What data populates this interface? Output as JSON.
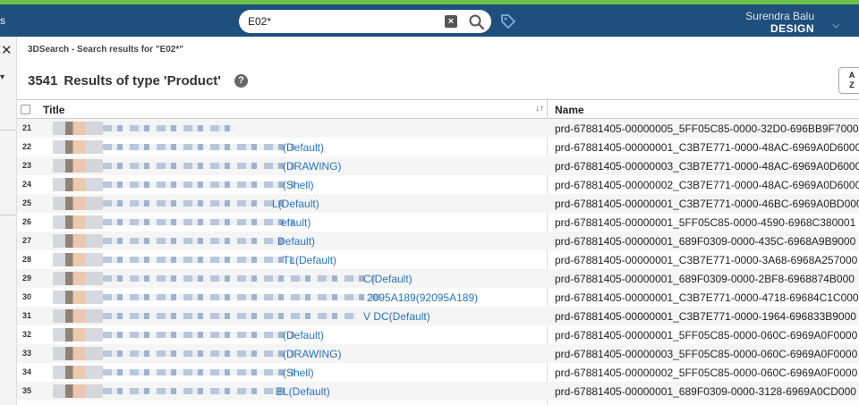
{
  "header": {
    "left_label": "s",
    "search_value": "E02*",
    "user_name": "Surendra Balu",
    "user_role": "DESIGN"
  },
  "breadcrumb": "3DSearch - Search results for \"E02*\"",
  "results": {
    "count": "3541",
    "label": "Results of type 'Product'"
  },
  "table": {
    "columns": [
      "Title",
      "Name"
    ],
    "rows": [
      {
        "num": "21",
        "title": "",
        "name": "prd-67881405-00000005_5FF05C85-0000-32D0-696BB9F7000"
      },
      {
        "num": "22",
        "title": "(Default)",
        "name": "prd-67881405-00000001_C3B7E771-0000-48AC-6969A0D6000"
      },
      {
        "num": "23",
        "title": "(DRAWING)",
        "name": "prd-67881405-00000003_C3B7E771-0000-48AC-6969A0D6000"
      },
      {
        "num": "24",
        "title": "(Shell)",
        "name": "prd-67881405-00000002_C3B7E771-0000-48AC-6969A0D6000"
      },
      {
        "num": "25",
        "title": "L(Default)",
        "name": "prd-67881405-00000001_C3B7E771-0000-46BC-6969A0BD000"
      },
      {
        "num": "26",
        "title": "efault)",
        "name": "prd-67881405-00000001_5FF05C85-0000-4590-6968C380001"
      },
      {
        "num": "27",
        "title": "Default)",
        "name": "prd-67881405-00000001_689F0309-0000-435C-6968A9B9000"
      },
      {
        "num": "28",
        "title": "TL(Default)",
        "name": "prd-67881405-00000001_C3B7E771-0000-3A68-6968A257000"
      },
      {
        "num": "29",
        "title": "C(Default)",
        "name": "prd-67881405-00000001_689F0309-0000-2BF8-6968874B000"
      },
      {
        "num": "30",
        "title": "2095A189(92095A189)",
        "name": "prd-67881405-00000001_C3B7E771-0000-4718-69684C1C000"
      },
      {
        "num": "31",
        "title": "V DC(Default)",
        "name": "prd-67881405-00000001_C3B7E771-0000-1964-696833B9000"
      },
      {
        "num": "32",
        "title": "(Default)",
        "name": "prd-67881405-00000001_5FF05C85-0000-060C-6969A0F0000"
      },
      {
        "num": "33",
        "title": "(DRAWING)",
        "name": "prd-67881405-00000003_5FF05C85-0000-060C-6969A0F0000"
      },
      {
        "num": "34",
        "title": "(Shell)",
        "name": "prd-67881405-00000002_5FF05C85-0000-060C-6969A0F0000"
      },
      {
        "num": "35",
        "title": "EL(Default)",
        "name": "prd-67881405-00000001_689F0309-0000-3128-6969A0CD000"
      }
    ]
  }
}
